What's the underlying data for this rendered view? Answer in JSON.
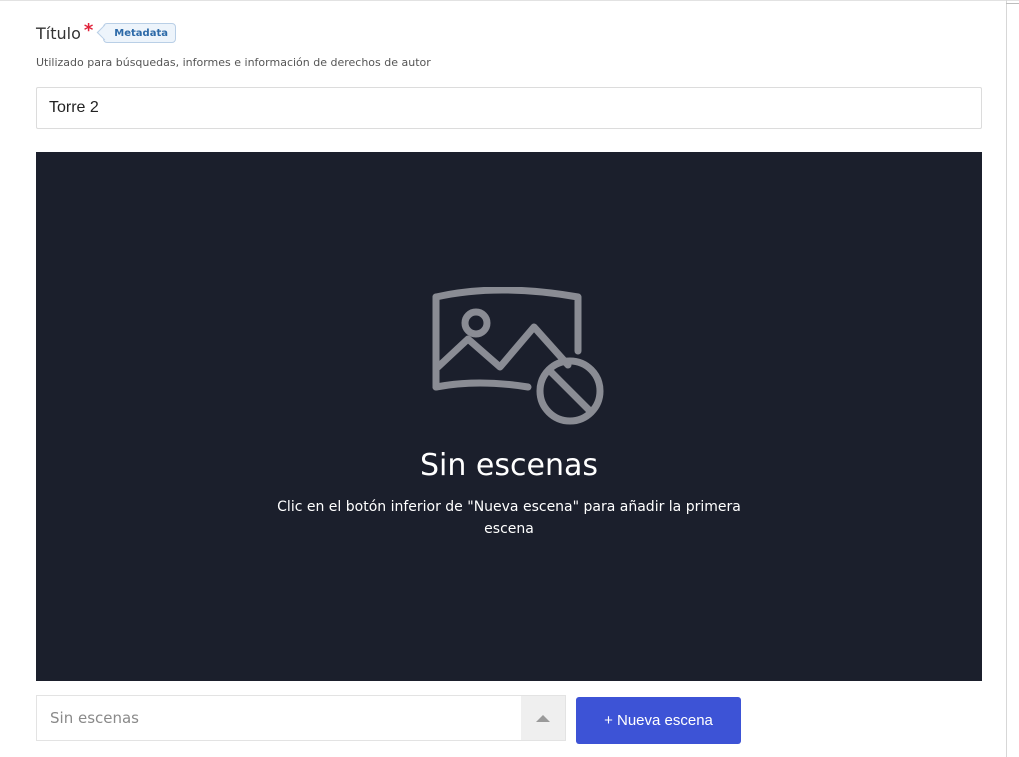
{
  "field": {
    "title_label": "Título",
    "required_mark": "*",
    "metadata_badge": "Metadata",
    "helper_text": "Utilizado para búsquedas, informes e información de derechos de autor",
    "value": "Torre 2"
  },
  "stage": {
    "icon": "image-off-icon",
    "empty_title": "Sin escenas",
    "empty_description": "Clic en el botón inferior de \"Nueva escena\" para añadir la primera escena"
  },
  "scene_picker": {
    "placeholder": "Sin escenas",
    "toggle_icon": "caret-up-icon"
  },
  "actions": {
    "new_scene_label": "+ Nueva escena"
  },
  "colors": {
    "stage_background": "#1b1f2c",
    "primary_button": "#3d53d6",
    "required": "#e0223a"
  }
}
